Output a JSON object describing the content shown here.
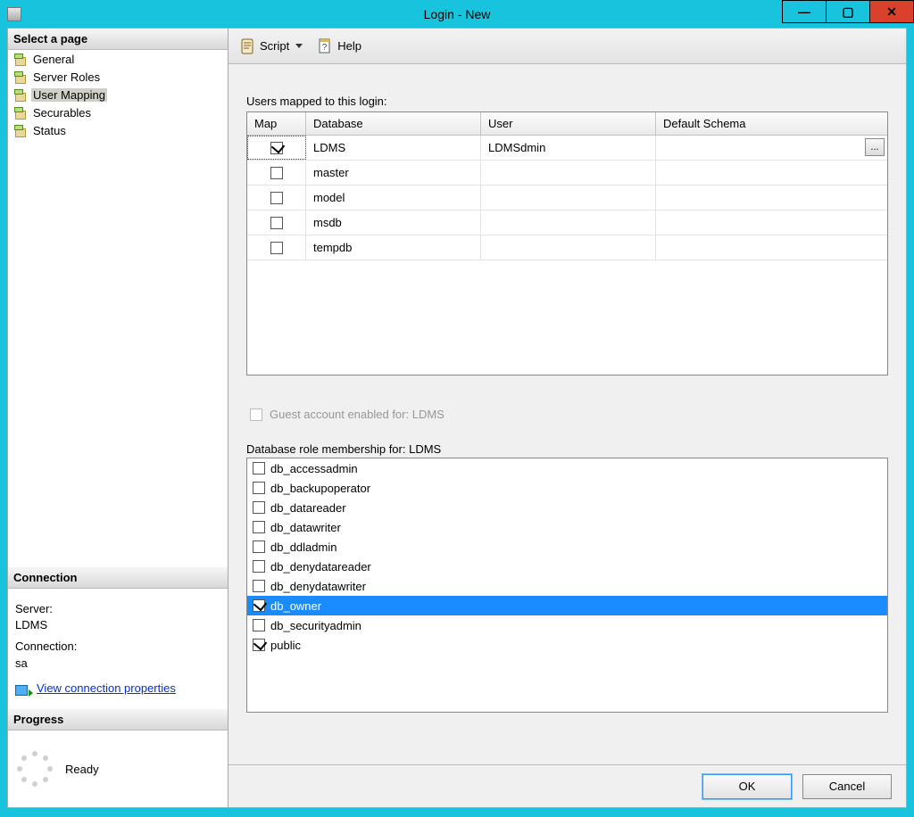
{
  "window": {
    "title": "Login - New"
  },
  "sidebar": {
    "header": "Select a page",
    "items": [
      {
        "label": "General",
        "selected": false
      },
      {
        "label": "Server Roles",
        "selected": false
      },
      {
        "label": "User Mapping",
        "selected": true
      },
      {
        "label": "Securables",
        "selected": false
      },
      {
        "label": "Status",
        "selected": false
      }
    ],
    "connection_header": "Connection",
    "server_label": "Server:",
    "server_value": "LDMS",
    "connection_label": "Connection:",
    "connection_value": "sa",
    "conn_link": "View connection properties",
    "progress_header": "Progress",
    "progress_status": "Ready"
  },
  "toolbar": {
    "script_label": "Script",
    "help_label": "Help"
  },
  "mapping": {
    "label": "Users mapped to this login:",
    "columns": {
      "map": "Map",
      "database": "Database",
      "user": "User",
      "schema": "Default Schema"
    },
    "rows": [
      {
        "checked": true,
        "database": "LDMS",
        "user": "LDMSdmin",
        "schema": "",
        "has_ellipsis": true,
        "selected": true
      },
      {
        "checked": false,
        "database": "master",
        "user": "",
        "schema": ""
      },
      {
        "checked": false,
        "database": "model",
        "user": "",
        "schema": ""
      },
      {
        "checked": false,
        "database": "msdb",
        "user": "",
        "schema": ""
      },
      {
        "checked": false,
        "database": "tempdb",
        "user": "",
        "schema": ""
      }
    ]
  },
  "guest": {
    "label": "Guest account enabled for: LDMS",
    "checked": false,
    "enabled": false
  },
  "roles": {
    "label": "Database role membership for: LDMS",
    "items": [
      {
        "name": "db_accessadmin",
        "checked": false,
        "selected": false
      },
      {
        "name": "db_backupoperator",
        "checked": false,
        "selected": false
      },
      {
        "name": "db_datareader",
        "checked": false,
        "selected": false
      },
      {
        "name": "db_datawriter",
        "checked": false,
        "selected": false
      },
      {
        "name": "db_ddladmin",
        "checked": false,
        "selected": false
      },
      {
        "name": "db_denydatareader",
        "checked": false,
        "selected": false
      },
      {
        "name": "db_denydatawriter",
        "checked": false,
        "selected": false
      },
      {
        "name": "db_owner",
        "checked": true,
        "selected": true
      },
      {
        "name": "db_securityadmin",
        "checked": false,
        "selected": false
      },
      {
        "name": "public",
        "checked": true,
        "selected": false
      }
    ]
  },
  "buttons": {
    "ok": "OK",
    "cancel": "Cancel"
  }
}
